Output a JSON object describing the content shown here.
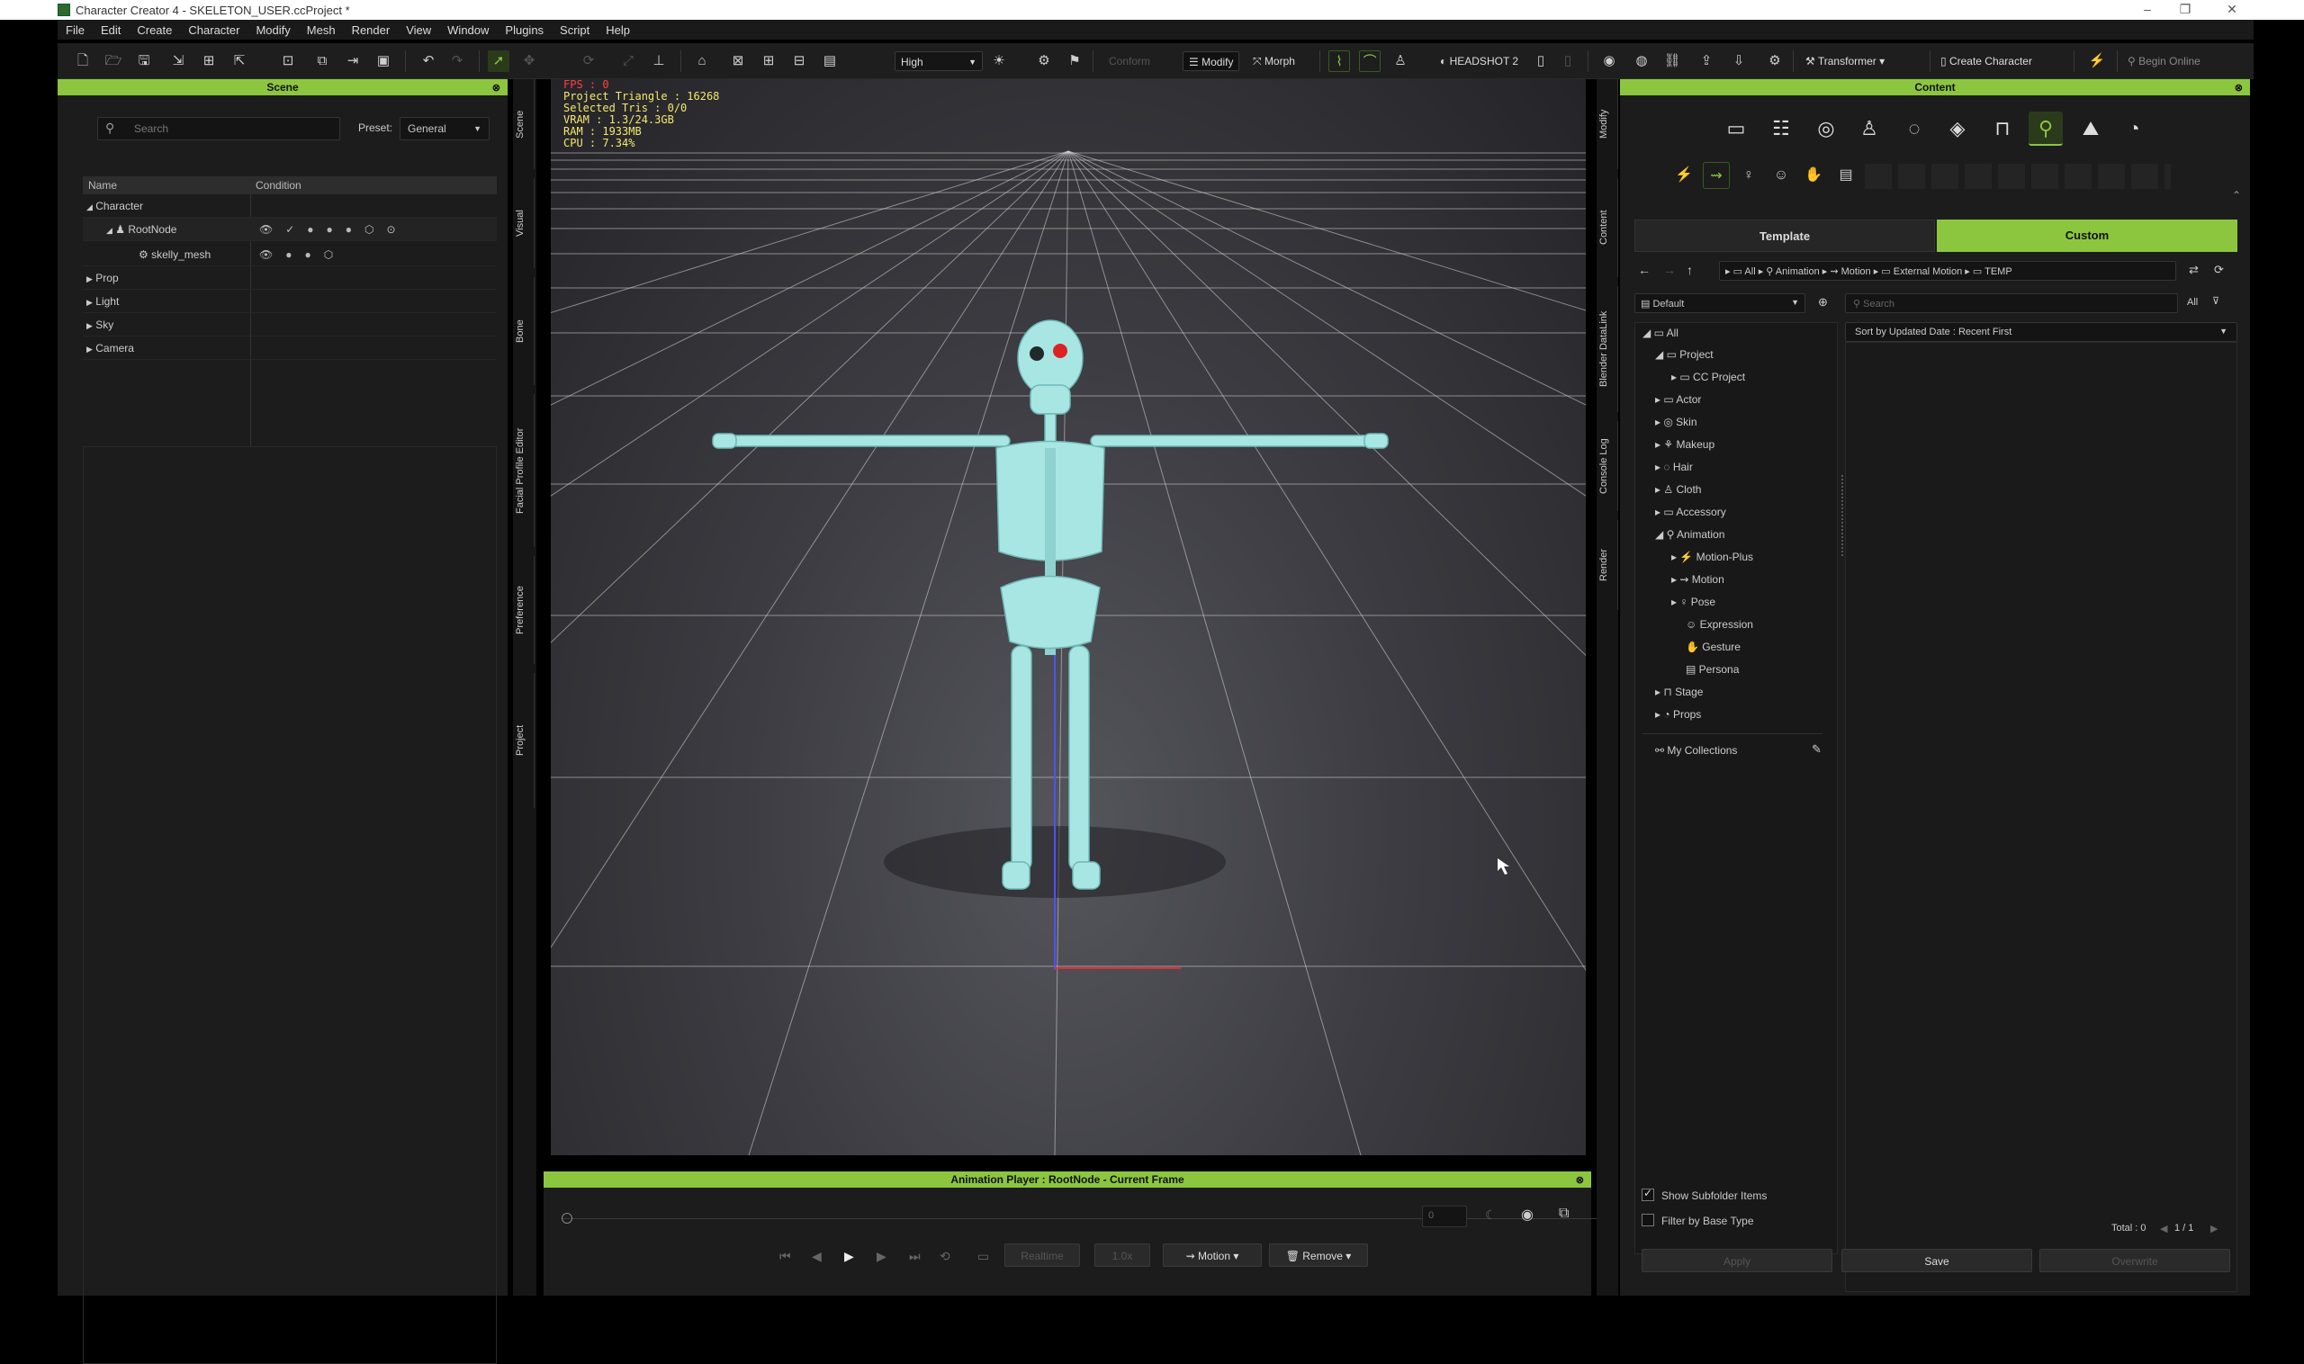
{
  "window": {
    "title": "Character Creator 4 - SKELETON_USER.ccProject *"
  },
  "menu": [
    "File",
    "Edit",
    "Create",
    "Character",
    "Modify",
    "Mesh",
    "Render",
    "View",
    "Window",
    "Plugins",
    "Script",
    "Help"
  ],
  "toolbar": {
    "quality": "High",
    "conform": "Conform",
    "modify": "Modify",
    "morph": "Morph",
    "headshot": "HEADSHOT 2",
    "transformer": "Transformer",
    "create_character": "Create Character",
    "begin_online": "Begin Online"
  },
  "scene": {
    "title": "Scene",
    "search_placeholder": "Search",
    "preset_label": "Preset:",
    "preset_value": "General",
    "col_name": "Name",
    "col_condition": "Condition",
    "items": {
      "character": "Character",
      "rootnode": "RootNode",
      "mesh": "skelly_mesh",
      "prop": "Prop",
      "light": "Light",
      "sky": "Sky",
      "camera": "Camera"
    }
  },
  "left_tabs": [
    "Scene",
    "Visual",
    "Bone",
    "Facial Profile Editor",
    "Preference",
    "Project"
  ],
  "right_tabs": [
    "Modify",
    "Content",
    "Blender DataLink",
    "Console Log",
    "Render"
  ],
  "stats": [
    "FPS : 0",
    "Project Triangle : 16268",
    "Selected Tris : 0/0",
    "VRAM : 1.3/24.3GB",
    "RAM : 1933MB",
    "CPU : 7.34%"
  ],
  "anim": {
    "title": "Animation Player : RootNode - Current Frame",
    "frame": "0",
    "realtime": "Realtime",
    "speed": "1.0x",
    "motion": "Motion",
    "remove": "Remove"
  },
  "content": {
    "title": "Content",
    "tab_template": "Template",
    "tab_custom": "Custom",
    "breadcrumb": [
      "All",
      "Animation",
      "Motion",
      "External Motion",
      "TEMP"
    ],
    "filter": "Default",
    "search_placeholder": "Search",
    "all_label": "All",
    "sort": "Sort by Updated Date : Recent First",
    "tree": {
      "all": "All",
      "project": "Project",
      "cc_project": "CC Project",
      "actor": "Actor",
      "skin": "Skin",
      "makeup": "Makeup",
      "hair": "Hair",
      "cloth": "Cloth",
      "accessory": "Accessory",
      "animation": "Animation",
      "motion_plus": "Motion-Plus",
      "motion": "Motion",
      "pose": "Pose",
      "expression": "Expression",
      "gesture": "Gesture",
      "persona": "Persona",
      "stage": "Stage",
      "props": "Props",
      "collections": "My Collections"
    },
    "show_subfolder": "Show Subfolder Items",
    "filter_base": "Filter by Base Type",
    "total": "Total : 0",
    "page": "1 / 1",
    "apply": "Apply",
    "save": "Save",
    "overwrite": "Overwrite"
  },
  "colors": {
    "accent": "#8cc63f",
    "skeleton": "#a8e6e4"
  }
}
